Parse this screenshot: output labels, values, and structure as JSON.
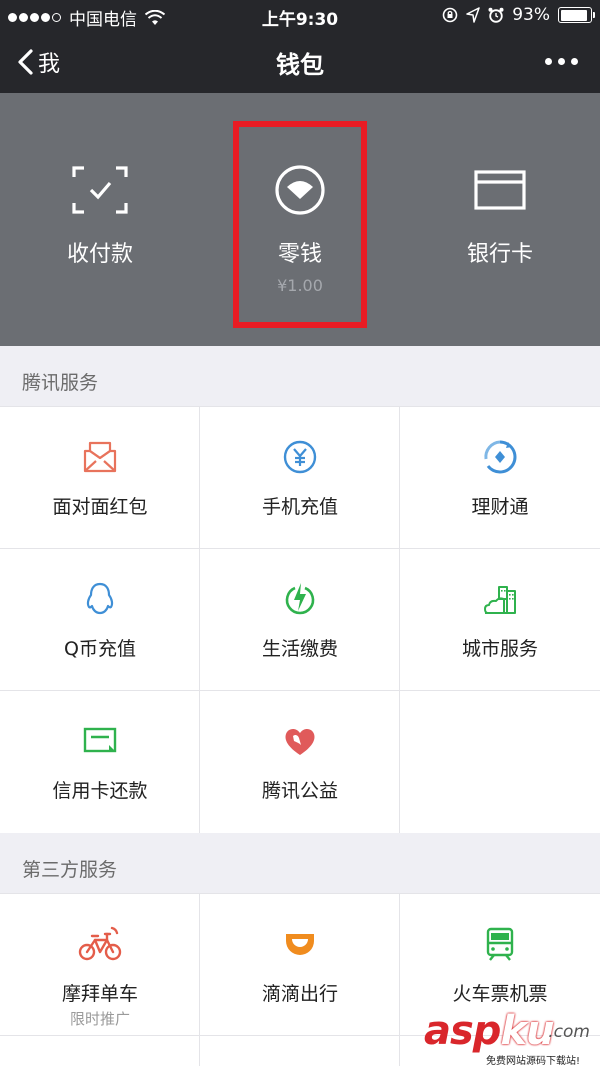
{
  "status_bar": {
    "carrier": "中国电信",
    "time": "上午9:30",
    "battery": "93%",
    "signal_strength": 4
  },
  "nav": {
    "back_label": "我",
    "title": "钱包"
  },
  "header": {
    "items": [
      {
        "label": "收付款",
        "icon": "scan-pay-icon"
      },
      {
        "label": "零钱",
        "sub": "¥1.00",
        "icon": "change-wallet-icon",
        "highlighted": true
      },
      {
        "label": "银行卡",
        "icon": "bank-card-icon"
      }
    ]
  },
  "tencent_services": {
    "title": "腾讯服务",
    "items": [
      {
        "label": "面对面红包",
        "icon": "red-packet-icon",
        "color": "#e8735c"
      },
      {
        "label": "手机充值",
        "icon": "yuan-coin-icon",
        "color": "#3f8fd6"
      },
      {
        "label": "理财通",
        "icon": "wealth-icon",
        "color": "#3f8fd6"
      },
      {
        "label": "Q币充值",
        "icon": "qq-penguin-icon",
        "color": "#3f8fd6"
      },
      {
        "label": "生活缴费",
        "icon": "utility-bolt-icon",
        "color": "#2fb24d"
      },
      {
        "label": "城市服务",
        "icon": "city-buildings-icon",
        "color": "#2fb24d"
      },
      {
        "label": "信用卡还款",
        "icon": "credit-card-icon",
        "color": "#2fb24d"
      },
      {
        "label": "腾讯公益",
        "icon": "charity-heart-icon",
        "color": "#e05a5a"
      }
    ]
  },
  "third_party_services": {
    "title": "第三方服务",
    "items": [
      {
        "label": "摩拜单车",
        "sub": "限时推广",
        "icon": "bicycle-icon",
        "color": "#e45d4a"
      },
      {
        "label": "滴滴出行",
        "icon": "didi-icon",
        "color": "#f08c1e"
      },
      {
        "label": "火车票机票",
        "icon": "train-icon",
        "color": "#2fb24d"
      }
    ]
  },
  "watermark": {
    "main_a": "asp",
    "main_b": "ku",
    "domain": ".com",
    "sub": "免费网站源码下载站!"
  }
}
